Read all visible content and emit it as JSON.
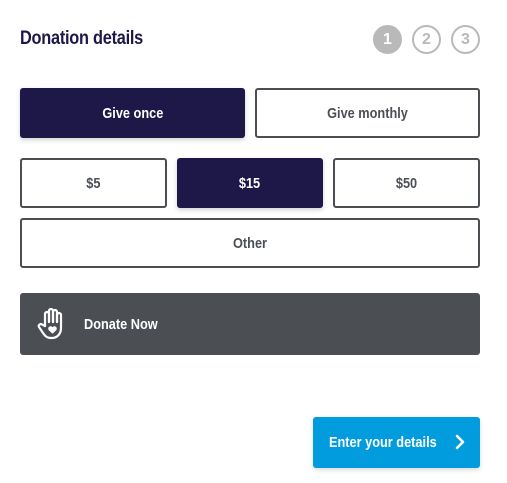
{
  "header": {
    "title": "Donation details"
  },
  "steps": [
    {
      "label": "1",
      "state": "active"
    },
    {
      "label": "2",
      "state": "inactive"
    },
    {
      "label": "3",
      "state": "inactive"
    }
  ],
  "frequency": {
    "once_label": "Give once",
    "monthly_label": "Give monthly",
    "selected": "once"
  },
  "amounts": {
    "options": [
      "$5",
      "$15",
      "$50"
    ],
    "other_label": "Other",
    "selected": "$15"
  },
  "donate": {
    "label": "Donate Now",
    "icon": "hand-heart-icon"
  },
  "next": {
    "label": "Enter your details",
    "icon": "chevron-right-icon"
  },
  "colors": {
    "primary_navy": "#1e1848",
    "outline_gray": "#4b4f54",
    "step_gray": "#b9b9b9",
    "accent_blue": "#009cde"
  }
}
